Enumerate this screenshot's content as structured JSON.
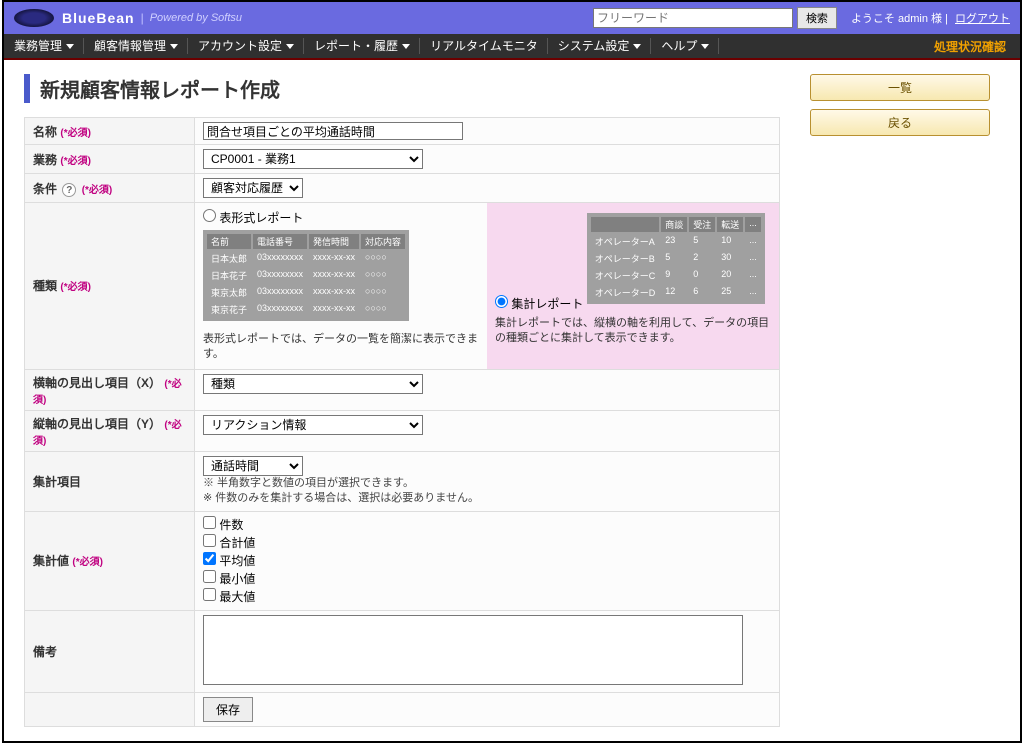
{
  "header": {
    "brand": "BlueBean",
    "powered": "Powered by Softsu",
    "search_placeholder": "フリーワード",
    "search_button": "検索",
    "welcome": "ようこそ admin 様",
    "logout": "ログアウト"
  },
  "menu": {
    "items": [
      "業務管理",
      "顧客情報管理",
      "アカウント設定",
      "レポート・履歴",
      "リアルタイムモニタ",
      "システム設定",
      "ヘルプ"
    ],
    "has_caret": [
      true,
      true,
      true,
      true,
      false,
      true,
      true
    ],
    "status_link": "処理状況確認"
  },
  "page_title": "新規顧客情報レポート作成",
  "side": {
    "list_btn": "一覧",
    "back_btn": "戻る"
  },
  "form": {
    "required": "(*必須)",
    "name": {
      "label": "名称",
      "value": "問合せ項目ごとの平均通話時間"
    },
    "business": {
      "label": "業務",
      "selected": "CP0001 - 業務1"
    },
    "condition": {
      "label": "条件",
      "selected": "顧客対応履歴"
    },
    "type": {
      "label": "種類",
      "opt1": {
        "label": "表形式レポート",
        "desc": "表形式レポートでは、データの一覧を簡潔に表示できます。",
        "sample_headers": [
          "名前",
          "電話番号",
          "発信時間",
          "対応内容"
        ],
        "sample_rows": [
          [
            "日本太郎",
            "03xxxxxxxx",
            "xxxx-xx-xx",
            "○○○○"
          ],
          [
            "日本花子",
            "03xxxxxxxx",
            "xxxx-xx-xx",
            "○○○○"
          ],
          [
            "東京太郎",
            "03xxxxxxxx",
            "xxxx-xx-xx",
            "○○○○"
          ],
          [
            "東京花子",
            "03xxxxxxxx",
            "xxxx-xx-xx",
            "○○○○"
          ]
        ]
      },
      "opt2": {
        "label": "集計レポート",
        "desc": "集計レポートでは、縦横の軸を利用して、データの項目の種類ごとに集計して表示できます。",
        "sample_headers": [
          "",
          "商談",
          "受注",
          "転送",
          "..."
        ],
        "sample_rows": [
          [
            "オペレーターA",
            "23",
            "5",
            "10",
            "..."
          ],
          [
            "オペレーターB",
            "5",
            "2",
            "30",
            "..."
          ],
          [
            "オペレーターC",
            "9",
            "0",
            "20",
            "..."
          ],
          [
            "オペレーターD",
            "12",
            "6",
            "25",
            "..."
          ]
        ]
      },
      "selected": "opt2"
    },
    "xaxis": {
      "label": "横軸の見出し項目（X）",
      "selected": "種類"
    },
    "yaxis": {
      "label": "縦軸の見出し項目（Y）",
      "selected": "リアクション情報"
    },
    "agg_item": {
      "label": "集計項目",
      "selected": "通話時間",
      "note1": "※ 半角数字と数値の項目が選択できます。",
      "note2": "※ 件数のみを集計する場合は、選択は必要ありません。"
    },
    "agg_value": {
      "label": "集計値",
      "opts": [
        "件数",
        "合計値",
        "平均値",
        "最小値",
        "最大値"
      ],
      "checked": [
        false,
        false,
        true,
        false,
        false
      ]
    },
    "remark": {
      "label": "備考",
      "value": ""
    },
    "save": "保存"
  }
}
